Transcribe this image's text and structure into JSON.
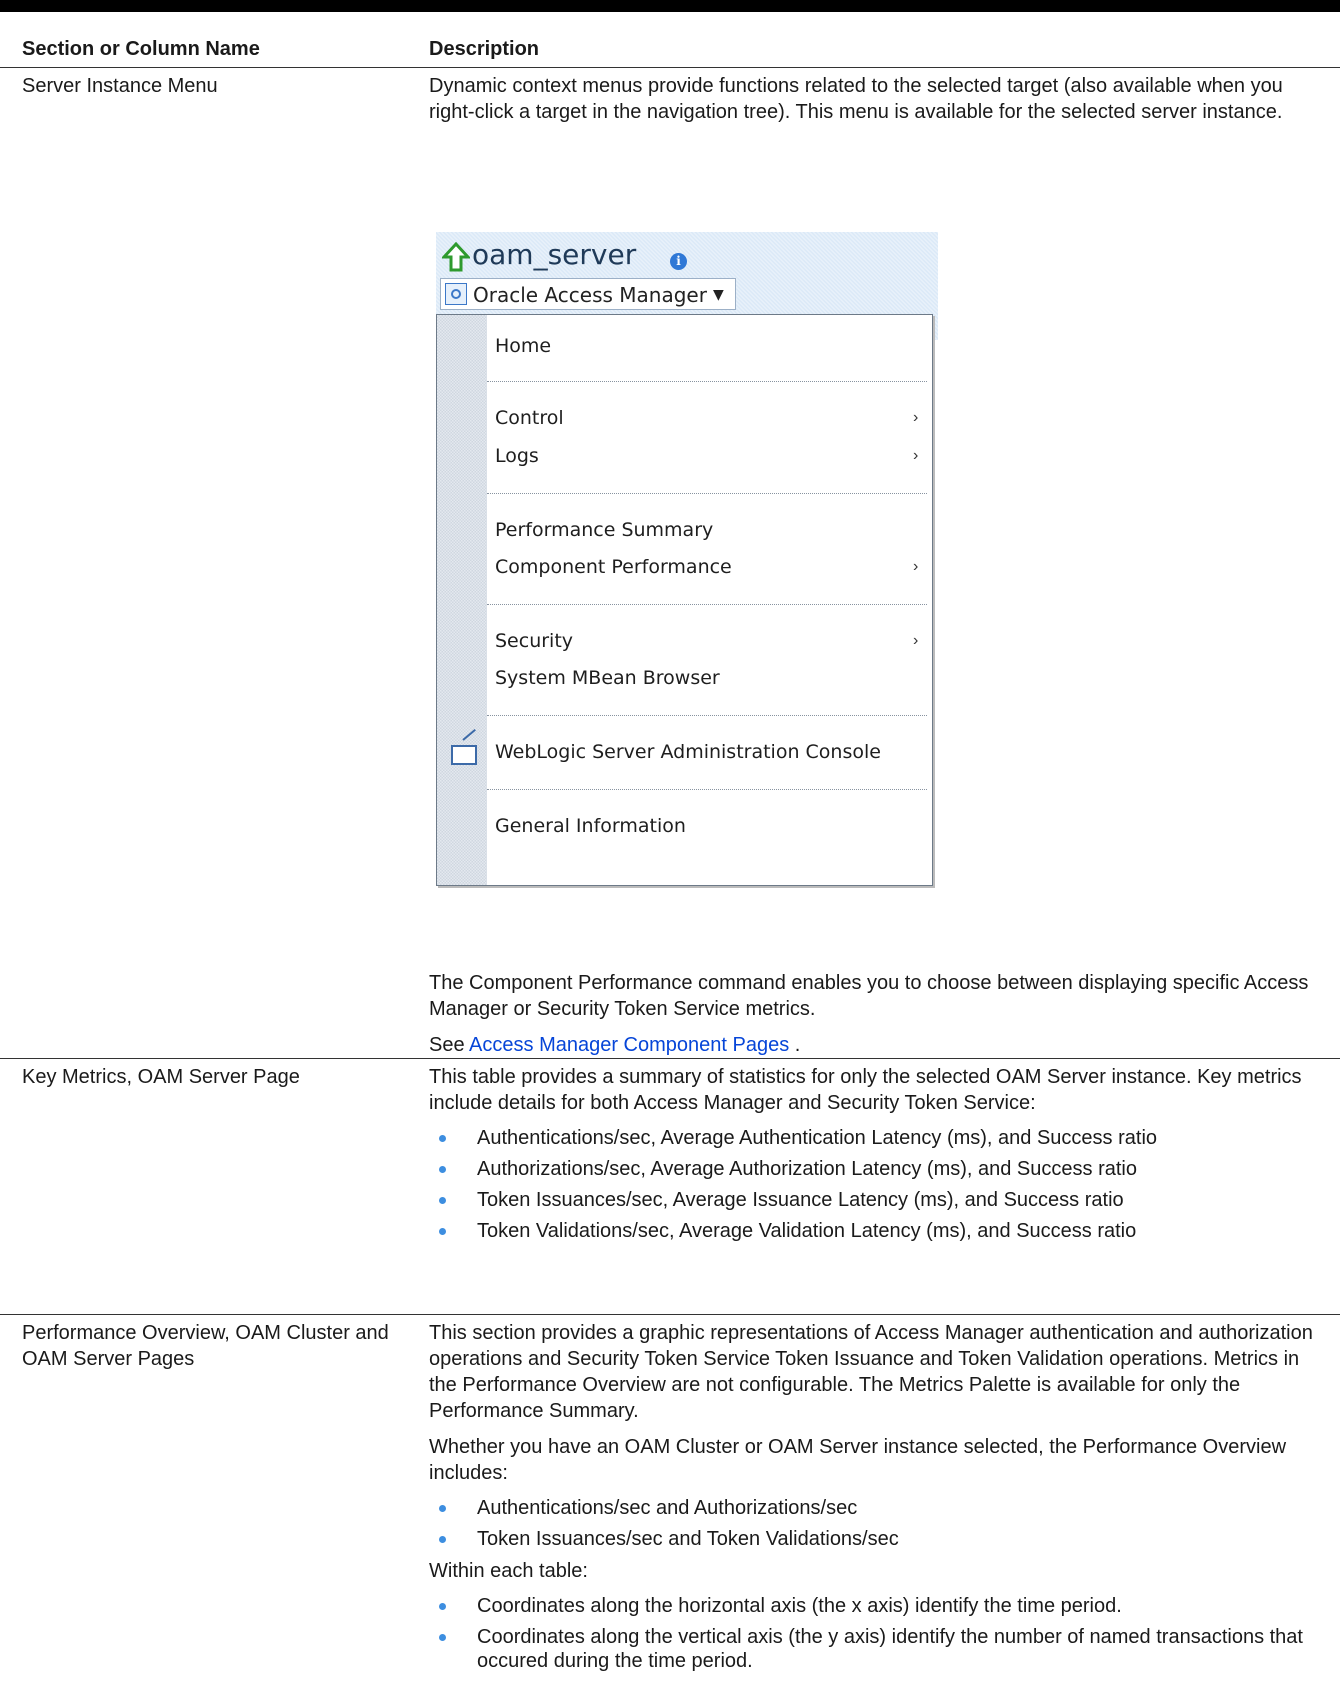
{
  "header": {
    "col1": "Section or Column Name",
    "col2": "Description"
  },
  "row1": {
    "name": "Server Instance Menu",
    "desc1": "Dynamic context menus provide functions related to the selected target (also available when you right-click a target in the navigation tree). This menu is available for the selected server instance.",
    "screenshot": {
      "server_name": "oam_server",
      "button_label": "Oracle Access Manager",
      "menu": {
        "home": "Home",
        "control": "Control",
        "logs": "Logs",
        "performance_summary": "Performance Summary",
        "component_performance": "Component Performance",
        "security": "Security",
        "system_mbean_browser": "System MBean Browser",
        "weblogic_console": "WebLogic Server Administration Console",
        "general_information": "General Information"
      }
    },
    "desc2": "The Component Performance command enables you to choose between displaying specific Access Manager or Security Token Service metrics.",
    "see_prefix": "See ",
    "see_link": "Access Manager Component Pages",
    "see_suffix": " ."
  },
  "row2": {
    "name": "Key Metrics, OAM Server Page",
    "desc": "This table provides a summary of statistics for only the selected OAM Server instance. Key metrics include details for both Access Manager and Security Token Service:",
    "bullets": [
      "Authentications/sec, Average Authentication Latency (ms), and Success ratio",
      "Authorizations/sec, Average Authorization Latency (ms), and Success ratio",
      "Token Issuances/sec, Average Issuance Latency (ms), and Success ratio",
      "Token Validations/sec, Average Validation Latency (ms), and Success ratio"
    ]
  },
  "row3": {
    "name": "Performance Overview, OAM Cluster and OAM Server Pages",
    "desc1": "This section provides a graphic representations of Access Manager authentication and authorization operations and Security Token Service Token Issuance and Token Validation operations. Metrics in the Performance Overview are not configurable. The Metrics Palette is available for only the Performance Summary.",
    "desc2": "Whether you have an OAM Cluster or OAM Server instance selected, the Performance Overview includes:",
    "bullets1": [
      "Authentications/sec and Authorizations/sec",
      "Token Issuances/sec and Token Validations/sec"
    ],
    "desc3": "Within each table:",
    "bullets2": [
      "Coordinates along the horizontal axis (the x axis) identify the time period.",
      "Coordinates along the vertical axis (the y axis) identify the number of named transactions that occured during the time period."
    ]
  },
  "colors": {
    "link": "#0645d8",
    "bullet": "#3d8ee0",
    "banner": "#dbe9f7"
  }
}
